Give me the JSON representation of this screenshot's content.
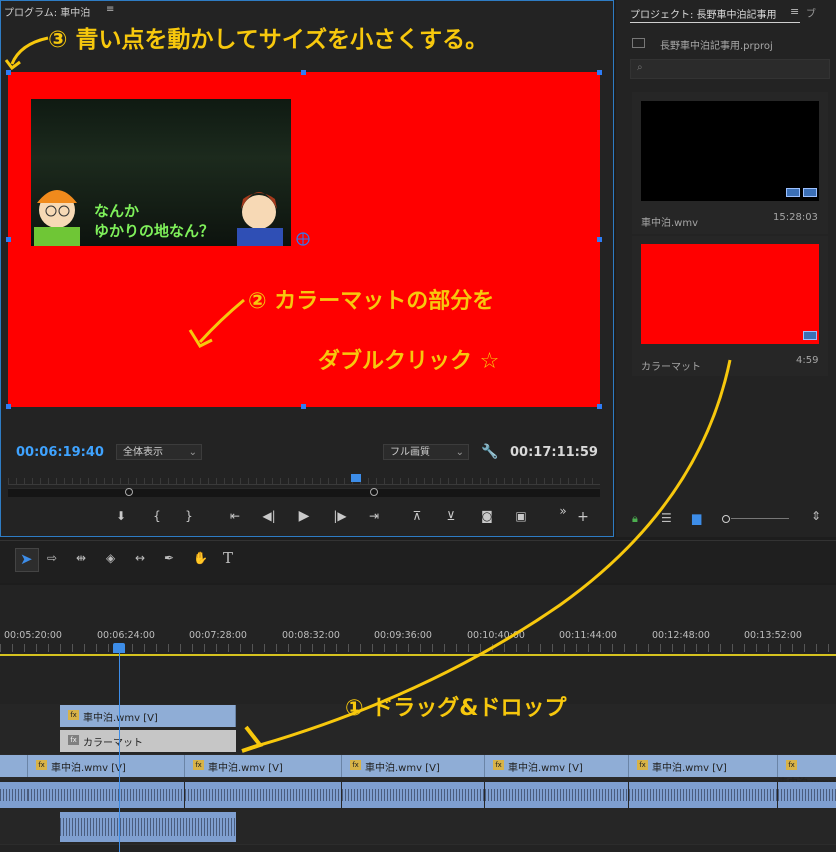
{
  "program_monitor": {
    "tab_label": "プログラム: 車中泊",
    "current_timecode": "00:06:19:40",
    "zoom_select": "全体表示",
    "quality_select": "フル画質",
    "duration_timecode": "00:17:11:59"
  },
  "video_overlay": {
    "speech_line1": "なんか",
    "speech_line2": "ゆかりの地なん？"
  },
  "project_panel": {
    "tab_label": "プロジェクト: 長野車中泊記事用",
    "file_name": "長野車中泊記事用.prproj",
    "items": [
      {
        "name": "車中泊.wmv",
        "duration": "15:28:03"
      },
      {
        "name": "カラーマット",
        "duration": "4:59"
      }
    ]
  },
  "timeline": {
    "ruler_labels": [
      "00:05:20:00",
      "00:06:24:00",
      "00:07:28:00",
      "00:08:32:00",
      "00:09:36:00",
      "00:10:40:00",
      "00:11:44:00",
      "00:12:48:00",
      "00:13:52:00"
    ],
    "v3_clip_label": "車中泊.wmv [V]",
    "matte_clip_label": "カラーマット",
    "v1_clip_label": "車中泊.wmv [V]"
  },
  "annotations": {
    "step3": "③ 青い点を動かしてサイズを小さくする。",
    "step2_line1": "② カラーマットの部分を",
    "step2_line2": "ダブルクリック ☆",
    "step1": "① ドラッグ&ドロップ"
  },
  "colors": {
    "accent_blue": "#3d8de8",
    "annotation_yellow": "#f7c80d",
    "matte_red": "#ff0000"
  }
}
